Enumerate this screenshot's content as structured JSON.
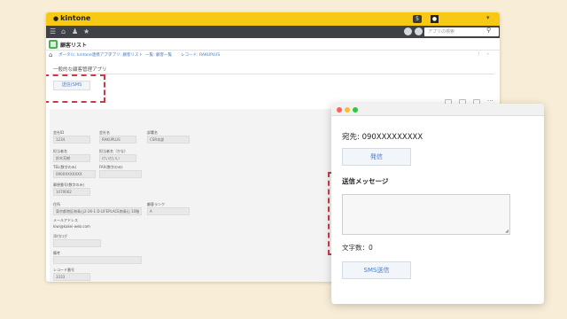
{
  "app": {
    "logo_text": "kintone",
    "app_title": "顧客リスト",
    "search_placeholder": "アプリの検索",
    "page_title": "一般的な顧客管理アプリ"
  },
  "breadcrumb": [
    "ポータル: kintone連携アプリ",
    "アプリ: 顧客リスト",
    "一覧: 顧客一覧",
    "レコード: RAKUPLUS"
  ],
  "buttons": {
    "sms_label": "送信(SMS"
  },
  "form": {
    "fields": [
      {
        "label": "会社ID",
        "value": "1234"
      },
      {
        "label": "会社名",
        "value": "RAKUPLUS"
      },
      {
        "label": "部署名",
        "value": "CSR本部"
      },
      {
        "label": "担当者名",
        "value": "鈴木芳樹"
      },
      {
        "label": "担当者名（かな)",
        "value": "けいだいい"
      },
      {
        "label": "TEL(数字のみ)",
        "value": "090XXXXXXXX"
      },
      {
        "label": "FAX(数字のみ)",
        "value": ""
      },
      {
        "label": "郵便番号(数字のみ)",
        "value": "1070062"
      },
      {
        "label": "住所",
        "value": "東京都港区南青山2-26-1 D-LIFEPLACE南青山 10階"
      },
      {
        "label": "顧客ランク",
        "value": "A"
      },
      {
        "label": "メールアドレス",
        "value": "kiwi@kakei-web.com"
      },
      {
        "label": "添付ログ",
        "value": ""
      },
      {
        "label": "備考",
        "value": ""
      },
      {
        "label": "レコード番号",
        "value": "3333"
      }
    ]
  },
  "popup": {
    "to_label": "宛先: 090XXXXXXXXX",
    "send_button": "発信",
    "message_label": "送信メッセージ",
    "char_count": "文字数：0",
    "sms_send_button": "SMS送信"
  },
  "colors": {
    "background": "#f8eed8",
    "header_yellow": "#f7c814",
    "nav_dark": "#3e4246",
    "highlight_dash": "#c73c46",
    "link_blue": "#4a7cc2"
  }
}
